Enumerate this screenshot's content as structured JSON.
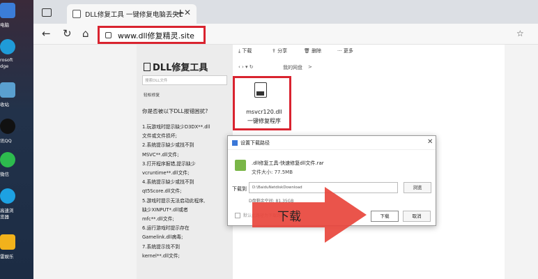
{
  "desktop": {
    "items": [
      {
        "label": "电脑",
        "color": "#3b7dd8"
      },
      {
        "label": "rosoft",
        "color": "#1f9bd8"
      },
      {
        "label": "dge",
        "color": "#1f9bd8"
      },
      {
        "label": "收站",
        "color": "#5aa0d0"
      },
      {
        "label": "讯QQ",
        "color": "#111111"
      },
      {
        "label": "微信",
        "color": "#2dbb4e"
      },
      {
        "label": "高速浏",
        "color": "#1da1e2"
      },
      {
        "label": "览器",
        "color": "#1da1e2"
      },
      {
        "label": "雷娱乐",
        "color": "#f2b21b"
      }
    ]
  },
  "browser": {
    "tab_title": "DLL修复工具 一键修复电脑丢失DLL文件",
    "tab_close": "✕",
    "new_tab": "+",
    "url": "www.dll修复精灵.site",
    "nav": {
      "back": "←",
      "refresh": "↻",
      "home": "⌂",
      "fav": "☆"
    }
  },
  "article": {
    "title": "DLL修复工具",
    "search_placeholder": "搜索DLL文件",
    "subtitle": "轻松修复",
    "question": "你是否被以下DLL报错困扰?",
    "list": [
      "1.玩游戏时提示缺少D3DX**.dll",
      "  文件或文件损坏;",
      "2.系统提示缺少或找不到",
      "  MSVC**.dll文件;",
      "3.打开程序报错,提示缺少",
      "  vcruntime**.dll文件;",
      "4.系统提示缺少或找不到",
      "  qt5Score.dll文件;",
      "5.游戏时提示无法启动此程序,",
      "  缺少XINPUT*.dll或者",
      "  mfc**.dll文件;",
      "6.运行游戏时提示存在",
      "  Gamelink.dll病毒;",
      "7.系统提示找不到",
      "  kernel**.dll文件;"
    ]
  },
  "files": {
    "toolbar": {
      "download": "下载",
      "share": "分享",
      "delete": "删除",
      "more": "更多"
    },
    "breadcrumb": {
      "nav": "‹ › ▾ ↻",
      "path": "我的网盘",
      "sep": ">"
    },
    "file": {
      "name1": "msvcr120.dll",
      "name2": "一键修复程序"
    }
  },
  "dialog": {
    "title": "设置下载路径",
    "close": "✕",
    "file_name": ".dll修复工具-快速修复dll文件.rar",
    "file_size": "文件大小: 77.5MB",
    "path_label": "下载到",
    "path_value": "D:\\BaiduNetdiskDownload",
    "browse": "浏览",
    "free_space": "D盘剩余空间: 81.35GB",
    "checkbox_label": "默认此路径为下载路径",
    "download_button": "下载",
    "cancel_button": "取消"
  },
  "overlay": {
    "label": "下载",
    "arrow_color": "#e8453c"
  }
}
